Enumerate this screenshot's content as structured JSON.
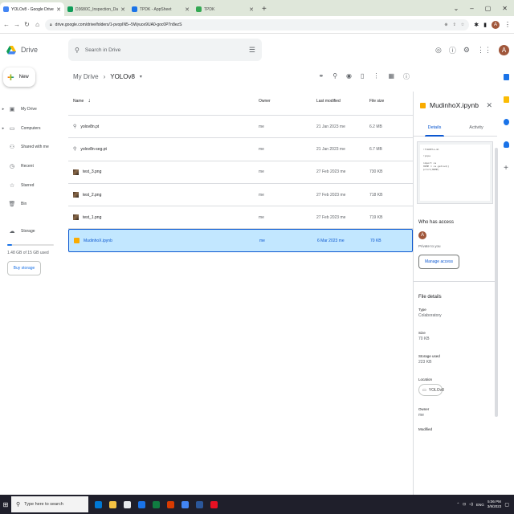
{
  "browser": {
    "tabs": [
      {
        "label": "YOLOv8 - Google Drive",
        "color": "#4285f4",
        "active": true
      },
      {
        "label": "D3680C_Inspection_Data_0703...",
        "color": "#0f9d58",
        "active": false
      },
      {
        "label": "TPDK - AppSheet",
        "color": "#1a73e8",
        "active": false
      },
      {
        "label": "TPDK",
        "color": "#34a853",
        "active": false
      }
    ],
    "new_tab": "+",
    "url": "drive.google.com/drive/folders/1-pvopIN5--5Wyuce9UA0-goc0P7n8ezS",
    "window_controls": [
      "⌄",
      "–",
      "▢",
      "✕"
    ]
  },
  "drive": {
    "app_name": "Drive",
    "search_placeholder": "Search in Drive",
    "new_label": "New",
    "avatar_letter": "A",
    "sidebar": [
      {
        "label": "My Drive",
        "icon": "drive-icon",
        "caret": "▸"
      },
      {
        "label": "Computers",
        "icon": "computer-icon",
        "caret": "▸"
      },
      {
        "label": "Shared with me",
        "icon": "people-icon",
        "caret": ""
      },
      {
        "label": "Recent",
        "icon": "clock-icon",
        "caret": ""
      },
      {
        "label": "Starred",
        "icon": "star-icon",
        "caret": ""
      },
      {
        "label": "Bin",
        "icon": "bin-icon",
        "caret": ""
      }
    ],
    "storage_label": "Storage",
    "storage_used": "1.48 GB of 15 GB used",
    "storage_fraction": 0.099,
    "buy_storage": "Buy storage"
  },
  "main": {
    "breadcrumb_root": "My Drive",
    "breadcrumb_sep": "›",
    "breadcrumb_current": "YOLOv8",
    "columns": {
      "name": "Name",
      "sort": "↓",
      "owner": "Owner",
      "modified": "Last modified",
      "size": "File size"
    },
    "files": [
      {
        "name": "yolov8n.pt",
        "type": "pt",
        "owner": "me",
        "modified": "21 Jan 2023 me",
        "size": "6.2 MB",
        "selected": false
      },
      {
        "name": "yolov8n-seg.pt",
        "type": "pt",
        "owner": "me",
        "modified": "21 Jan 2023 me",
        "size": "6.7 MB",
        "selected": false
      },
      {
        "name": "test_3.png",
        "type": "img",
        "owner": "me",
        "modified": "27 Feb 2023 me",
        "size": "730 KB",
        "selected": false
      },
      {
        "name": "test_2.png",
        "type": "img",
        "owner": "me",
        "modified": "27 Feb 2023 me",
        "size": "718 KB",
        "selected": false
      },
      {
        "name": "test_1.png",
        "type": "img",
        "owner": "me",
        "modified": "27 Feb 2023 me",
        "size": "719 KB",
        "selected": false
      },
      {
        "name": "MudinhoX.ipynb",
        "type": "nb",
        "owner": "me",
        "modified": "6 Mar 2023 me",
        "size": "70 KB",
        "selected": true
      }
    ]
  },
  "panel": {
    "title": "MudinhoX.ipynb",
    "close": "✕",
    "tabs": [
      "Details",
      "Activity"
    ],
    "preview_code": "!fnUDEla-ml\n\n!pipe\n\nimport os\nHOME = os.getcwd()\nprint(HOME)",
    "access_heading": "Who has access",
    "access_avatar": "A",
    "private_text": "Private to you",
    "manage_access": "Manage access",
    "details_heading": "File details",
    "type_label": "Type",
    "type_value": "Colaboratory",
    "size_label": "Size",
    "size_value": "70 KB",
    "storage_label": "Storage used",
    "storage_value": "223 KB",
    "location_label": "Location",
    "location_value": "YOLOv8",
    "owner_label": "Owner",
    "owner_value": "me",
    "modified_label": "Modified"
  },
  "taskbar": {
    "search_placeholder": "Type here to search",
    "time": "5:06 PM",
    "date": "3/9/2023",
    "lang": "ENG",
    "app_colors": [
      "#0078d4",
      "#f6c343",
      "#e8eaed",
      "#1a73e8",
      "#107c41",
      "#d83b01",
      "#4285f4",
      "#2b579a",
      "#e81123"
    ]
  }
}
